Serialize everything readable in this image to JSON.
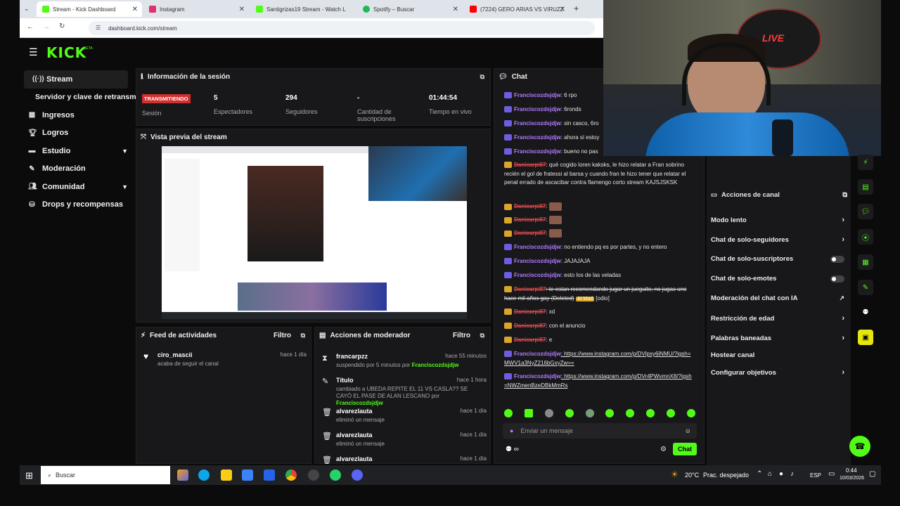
{
  "browser": {
    "tabs": [
      {
        "title": "Stream - Kick Dashboard",
        "color": "#53fc18"
      },
      {
        "title": "Instagram",
        "color": "#e1306c"
      },
      {
        "title": "Santigrizas19 Stream - Watch L",
        "color": "#53fc18"
      },
      {
        "title": "Spotify – Buscar",
        "color": "#1db954"
      },
      {
        "title": "(7224) GERO ARIAS VS VIRUZZ",
        "color": "#ff0000"
      }
    ],
    "url": "dashboard.kick.com/stream"
  },
  "brand": {
    "logo": "KICK",
    "beta": "BETA"
  },
  "sidebar": {
    "items": [
      {
        "label": "Stream",
        "icon": "stream-icon"
      },
      {
        "label": "Servidor y clave de retransm",
        "icon": ""
      },
      {
        "label": "Ingresos",
        "icon": "chart-icon"
      },
      {
        "label": "Logros",
        "icon": "trophy-icon"
      },
      {
        "label": "Estudio",
        "icon": "studio-icon"
      },
      {
        "label": "Moderación",
        "icon": "wrench-icon"
      },
      {
        "label": "Comunidad",
        "icon": "people-icon"
      },
      {
        "label": "Drops y recompensas",
        "icon": "drops-icon"
      }
    ]
  },
  "session": {
    "title": "Información de la sesión",
    "status_badge": "TRANSMITIENDO",
    "status_label": "Sesión",
    "viewers_value": "5",
    "viewers_label": "Espectadores",
    "followers_value": "294",
    "followers_label": "Seguidores",
    "subs_value": "-",
    "subs_label": "Cantidad de suscripciones",
    "uptime_value": "01:44:54",
    "uptime_label": "Tiempo en vivo"
  },
  "preview": {
    "title": "Vista previa del stream"
  },
  "activity": {
    "title": "Feed de actividades",
    "filter": "Filtro",
    "items": [
      {
        "name": "ciro_mascii",
        "desc": "acaba de seguir el canal",
        "time": "hace 1 día"
      }
    ]
  },
  "modactions": {
    "title": "Acciones de moderador",
    "filter": "Filtro",
    "items": [
      {
        "name": "francarpzz",
        "time": "hace 55 minutos",
        "desc": "suspendido por 5 minutos por",
        "by": "Franciscozdsjdjw"
      },
      {
        "name": "Título",
        "time": "hace 1 hora",
        "desc": "cambiado a UBEDA REPITE EL 11 VS CASLA?? SE CAYÓ EL PASE DE ALAN LESCANO por",
        "by": "Franciscozdsjdjw"
      },
      {
        "name": "alvarezlauta",
        "time": "hace 1 día",
        "desc": "eliminó un mensaje",
        "by": ""
      },
      {
        "name": "alvarezlauta",
        "time": "hace 1 día",
        "desc": "eliminó un mensaje",
        "by": ""
      },
      {
        "name": "alvarezlauta",
        "time": "hace 1 día",
        "desc": "",
        "by": ""
      }
    ]
  },
  "chat": {
    "title": "Chat",
    "messages": [
      {
        "user": "Franciscozdsjdjw",
        "text": ": 6 rpo",
        "removed": false
      },
      {
        "user": "Franciscozdsjdjw",
        "text": ": 6ronds",
        "removed": false
      },
      {
        "user": "Franciscozdsjdjw",
        "text": ": sin casco, 6ro",
        "removed": false
      },
      {
        "user": "Franciscozdsjdjw",
        "text": ": ahora sí estoy",
        "removed": false
      },
      {
        "user": "Franciscozdsjdjw",
        "text": ": bueno no pas",
        "removed": false
      },
      {
        "user": "Danicarpi87",
        "text": ": qué cogido loren kaksks, le hizo relatar a Fran sobrino recién el gol de fratessi al barsa y cuando fran le hizo tener que relatar el penal errado de ascacibar contra flamengo corto stream KAJSJSKSK",
        "removed": true
      },
      {
        "user": "Danicarpi87",
        "text": ":",
        "removed": true
      },
      {
        "user": "Danicarpi87",
        "text": ":",
        "removed": true
      },
      {
        "user": "Danicarpi87",
        "text": ":",
        "removed": true
      },
      {
        "user": "Franciscozdsjdjw",
        "text": ": no entiendo pq es por partes, y no entero",
        "removed": false
      },
      {
        "user": "Franciscozdsjdjw",
        "text": ": JAJAJAJA",
        "removed": false
      },
      {
        "user": "Franciscozdsjdjw",
        "text": ": esto los de las veladas",
        "removed": false
      },
      {
        "user": "Danicarpi87",
        "text": ": te estan recomendando jugar un jueguito, no jugas uno hace mil años gay (Deleted)",
        "removed": true
      },
      {
        "user": "Danicarpi87",
        "text": ": xd",
        "removed": true
      },
      {
        "user": "Danicarpi87",
        "text": ": con el anuncio",
        "removed": true
      },
      {
        "user": "Danicarpi87",
        "text": ": e",
        "removed": true
      },
      {
        "user": "Franciscozdsjdjw",
        "text": ": https://www.instagram.com/p/DVlpsy6iNMU/?igsh=MWV1a3NyZ216bGxyZw==",
        "removed": false
      },
      {
        "user": "Franciscozdsjdjw",
        "text": ": https://www.instagram.com/p/DVr4PWvmnX8/?igsh=NWZmenBzeDBkMmRs",
        "removed": false
      }
    ],
    "ai_mod_tag": "AI Mod",
    "odio_tag": "[odio]",
    "input_placeholder": "Enviar un mensaje",
    "send_label": "Chat"
  },
  "channel_actions": {
    "title": "Acciones de canal",
    "items": [
      {
        "label": "Modo lento",
        "control": "arrow"
      },
      {
        "label": "Chat de solo-seguidores",
        "control": "arrow"
      },
      {
        "label": "Chat de solo-suscriptores",
        "control": "toggle"
      },
      {
        "label": "Chat de solo-emotes",
        "control": "toggle"
      },
      {
        "label": "Moderación del chat con IA",
        "control": "external"
      },
      {
        "label": "Restricción de edad",
        "control": "arrow"
      },
      {
        "label": "Palabras baneadas",
        "control": "arrow"
      },
      {
        "label": "Hostear canal",
        "control": "none"
      },
      {
        "label": "Configurar objetivos",
        "control": "arrow"
      }
    ]
  },
  "webcam_overlay": {
    "live_badge": "LIVE"
  },
  "taskbar": {
    "search": "Buscar",
    "weather": "20°C",
    "weather_desc": "Prac. despejado",
    "lang": "ESP",
    "time": "0:44",
    "date": "10/03/2026"
  }
}
